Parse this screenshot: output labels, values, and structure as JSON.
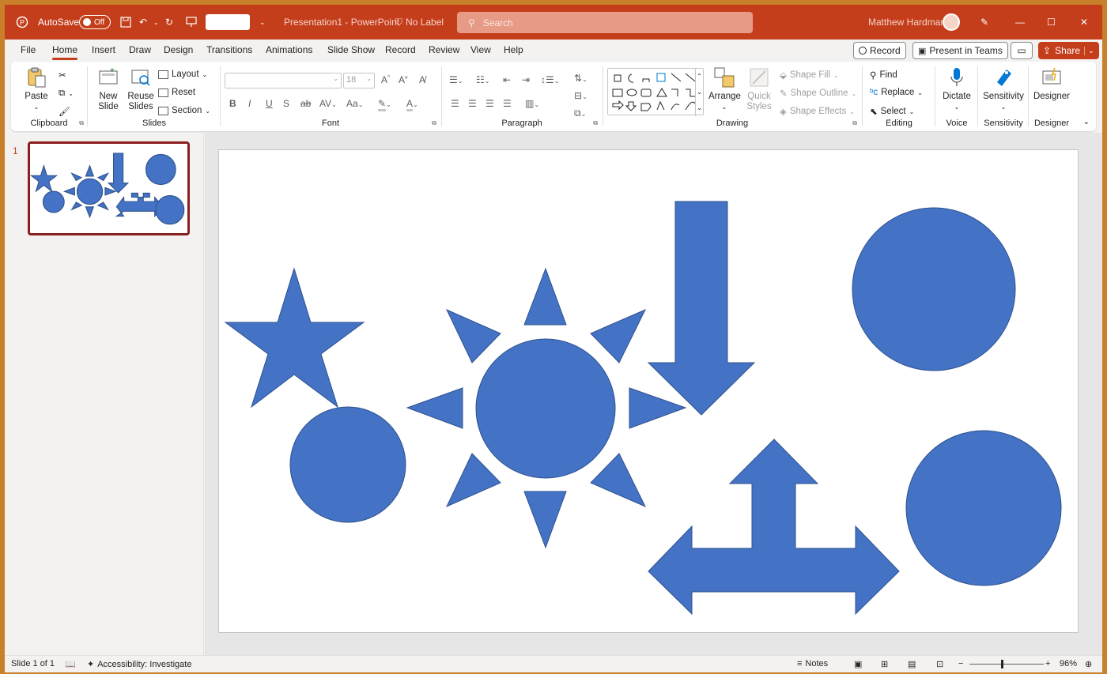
{
  "titlebar": {
    "autosave_label": "AutoSave",
    "autosave_state": "Off",
    "document_title": "Presentation1  -  PowerPoint",
    "label_status": "No Label",
    "search_placeholder": "Search",
    "user_name": "Matthew Hardman"
  },
  "tabs": [
    "File",
    "Home",
    "Insert",
    "Draw",
    "Design",
    "Transitions",
    "Animations",
    "Slide Show",
    "Record",
    "Review",
    "View",
    "Help"
  ],
  "active_tab": "Home",
  "top_buttons": {
    "record": "Record",
    "present_in_teams": "Present in Teams",
    "share": "Share"
  },
  "ribbon": {
    "clipboard": {
      "paste": "Paste",
      "label": "Clipboard"
    },
    "slides": {
      "new_slide_1": "New",
      "new_slide_2": "Slide",
      "reuse_1": "Reuse",
      "reuse_2": "Slides",
      "layout": "Layout",
      "reset": "Reset",
      "section": "Section",
      "label": "Slides"
    },
    "font": {
      "font_name": "",
      "font_size": "18",
      "label": "Font"
    },
    "paragraph": {
      "label": "Paragraph"
    },
    "drawing": {
      "arrange": "Arrange",
      "quick_styles_1": "Quick",
      "quick_styles_2": "Styles",
      "shape_fill": "Shape Fill",
      "shape_outline": "Shape Outline",
      "shape_effects": "Shape Effects",
      "label": "Drawing"
    },
    "editing": {
      "find": "Find",
      "replace": "Replace",
      "select": "Select",
      "label": "Editing"
    },
    "voice": {
      "dictate": "Dictate",
      "label": "Voice"
    },
    "sensitivity": {
      "button": "Sensitivity",
      "label": "Sensitivity"
    },
    "designer": {
      "button": "Designer",
      "label": "Designer"
    }
  },
  "thumbnail": {
    "number": "1"
  },
  "statusbar": {
    "slide_info": "Slide 1 of 1",
    "accessibility": "Accessibility: Investigate",
    "notes": "Notes",
    "zoom": "96%"
  },
  "colors": {
    "accent": "#c43e1c",
    "shape_fill": "#4472c4",
    "shape_outline": "#2f528f"
  }
}
